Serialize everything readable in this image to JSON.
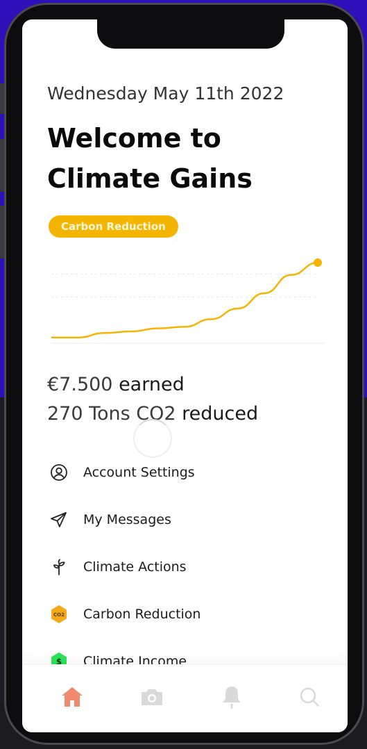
{
  "header": {
    "date": "Wednesday May 11th 2022",
    "title_line1": "Welcome to",
    "title_line2": "Climate Gains"
  },
  "filter_pill": {
    "label": "Carbon Reduction",
    "color": "#f3b500"
  },
  "chart_data": {
    "type": "line",
    "x": [
      0,
      1,
      2,
      3,
      4,
      5,
      6,
      7,
      8,
      9,
      10
    ],
    "values": [
      2,
      2,
      8,
      10,
      14,
      16,
      26,
      40,
      60,
      84,
      100
    ],
    "ylim": [
      0,
      100
    ],
    "grid": true,
    "line_color": "#f3b500"
  },
  "stats": {
    "earned_value": "€7.500",
    "earned_label": " earned",
    "reduced_value": "270 Tons CO2",
    "reduced_label": " reduced"
  },
  "menu": {
    "items": [
      {
        "label": "Account Settings",
        "icon": "user-circle-icon"
      },
      {
        "label": "My Messages",
        "icon": "paper-plane-icon"
      },
      {
        "label": "Climate Actions",
        "icon": "plant-icon"
      },
      {
        "label": "Carbon Reduction",
        "icon": "co2-badge-icon",
        "badge_text": "CO2"
      },
      {
        "label": "Climate Income",
        "icon": "dollar-hexagon-icon",
        "badge_text": "$"
      }
    ]
  },
  "tabbar": {
    "active_color": "#f08a6e",
    "inactive_color": "#d9d9d9",
    "tabs": [
      "home-icon",
      "camera-icon",
      "bell-icon",
      "search-icon"
    ]
  }
}
